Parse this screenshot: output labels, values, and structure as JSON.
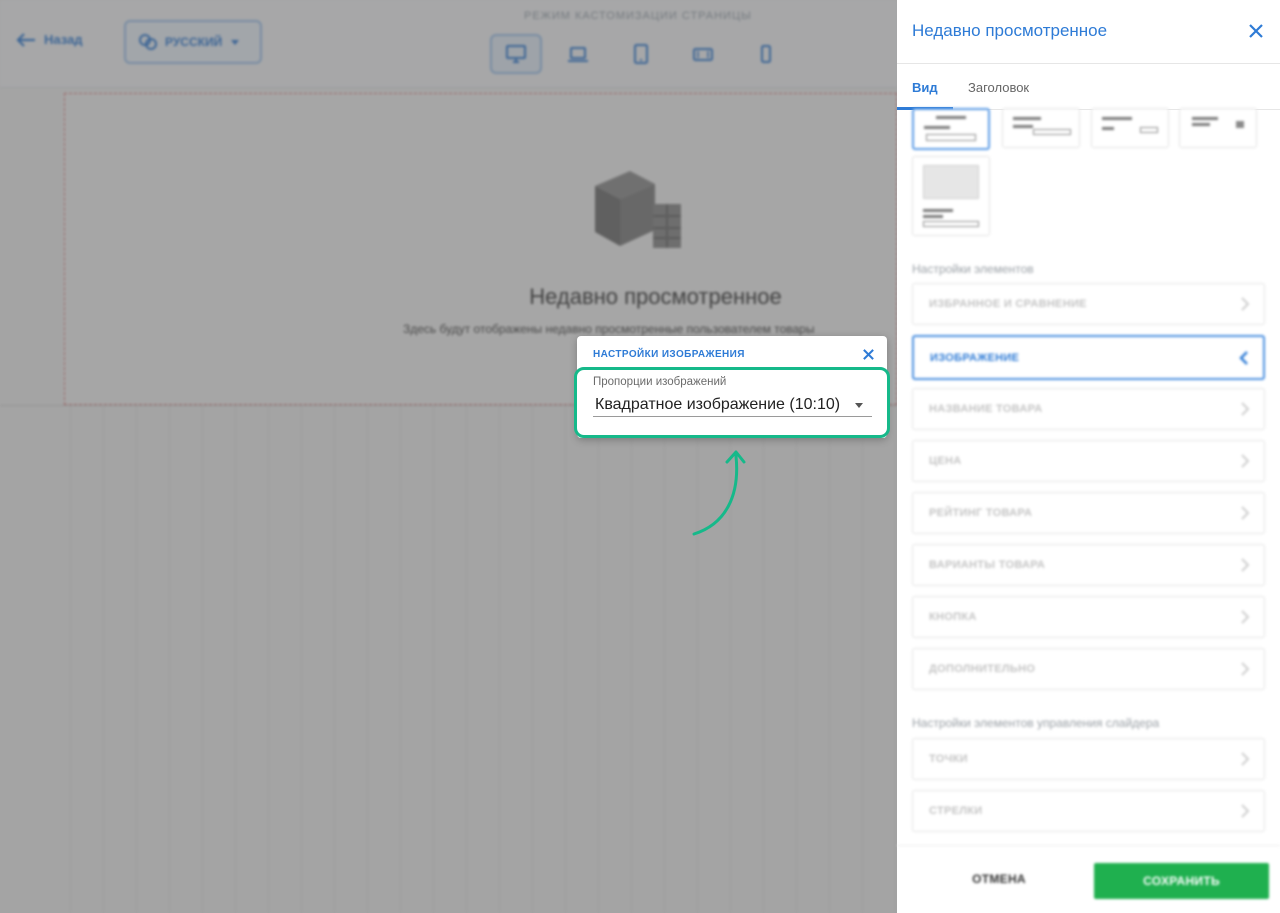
{
  "topbar": {
    "back_label": "Назад",
    "language_label": "РУССКИЙ",
    "mode_title": "РЕЖИМ КАСТОМИЗАЦИИ СТРАНИЦЫ",
    "devices": [
      "desktop-icon",
      "laptop-icon",
      "tablet-icon",
      "tablet-landscape-icon",
      "phone-icon"
    ],
    "active_device": "desktop-icon"
  },
  "canvas": {
    "empty_title": "Недавно просмотренное",
    "empty_subtitle": "Здесь будут отображены недавно просмотренные пользователем товары"
  },
  "popover": {
    "title": "НАСТРОЙКИ ИЗОБРАЖЕНИЯ",
    "field_label": "Пропорции изображений",
    "field_value": "Квадратное изображение (10:10)"
  },
  "panel": {
    "title": "Недавно просмотренное",
    "tabs": [
      {
        "label": "Вид",
        "active": true
      },
      {
        "label": "Заголовок",
        "active": false
      }
    ],
    "elements_section_label": "Настройки элементов",
    "elements": [
      {
        "label": "ИЗБРАННОЕ И СРАВНЕНИЕ",
        "expanded": false
      },
      {
        "label": "ИЗОБРАЖЕНИЕ",
        "expanded": true
      },
      {
        "label": "НАЗВАНИЕ ТОВАРА",
        "expanded": false
      },
      {
        "label": "ЦЕНА",
        "expanded": false
      },
      {
        "label": "РЕЙТИНГ ТОВАРА",
        "expanded": false
      },
      {
        "label": "ВАРИАНТЫ ТОВАРА",
        "expanded": false
      },
      {
        "label": "КНОПКА",
        "expanded": false
      },
      {
        "label": "ДОПОЛНИТЕЛЬНО",
        "expanded": false
      }
    ],
    "slider_section_label": "Настройки элементов управления слайдера",
    "slider_elements": [
      {
        "label": "ТОЧКИ"
      },
      {
        "label": "СТРЕЛКИ"
      }
    ],
    "cancel_label": "ОТМЕНА",
    "save_label": "СОХРАНИТЬ"
  },
  "colors": {
    "accent": "#2e7bd6",
    "highlight": "#16b98a",
    "save_button": "#1fb04f"
  }
}
